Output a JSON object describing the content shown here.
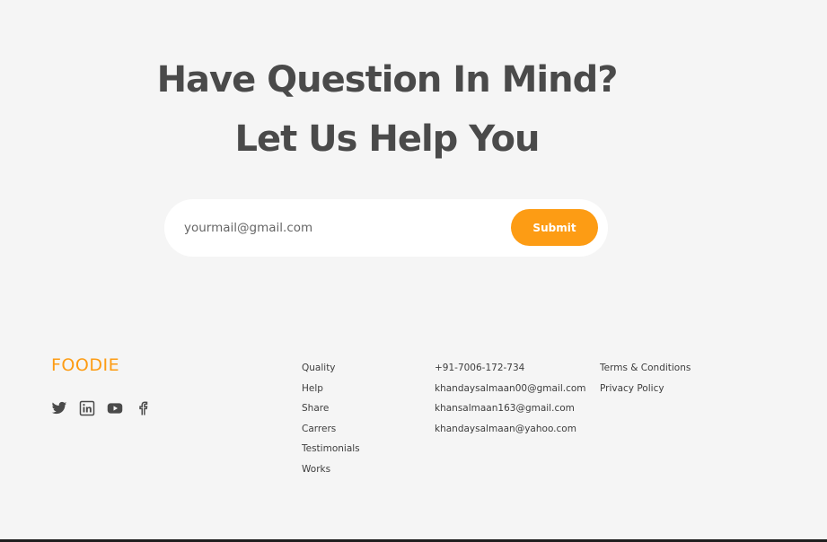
{
  "hero": {
    "line1": "Have Question In Mind?",
    "line2": "Let Us Help You"
  },
  "subscribe": {
    "placeholder": "yourmail@gmail.com",
    "submit_label": "Submit"
  },
  "footer": {
    "brand": "FOODIE",
    "social_icons": [
      "twitter-icon",
      "linkedin-icon",
      "youtube-icon",
      "facebook-icon"
    ],
    "links": [
      "Quality",
      "Help",
      "Share",
      "Carrers",
      "Testimonials",
      "Works"
    ],
    "contact": [
      "+91-7006-172-734",
      "khandaysalmaan00@gmail.com",
      "khansalmaan163@gmail.com",
      "khandaysalmaan@yahoo.com"
    ],
    "legal": [
      "Terms & Conditions",
      "Privacy Policy"
    ]
  },
  "colors": {
    "accent": "#fd9c14",
    "background": "#f5f5f5",
    "text": "#4a4a4a"
  }
}
